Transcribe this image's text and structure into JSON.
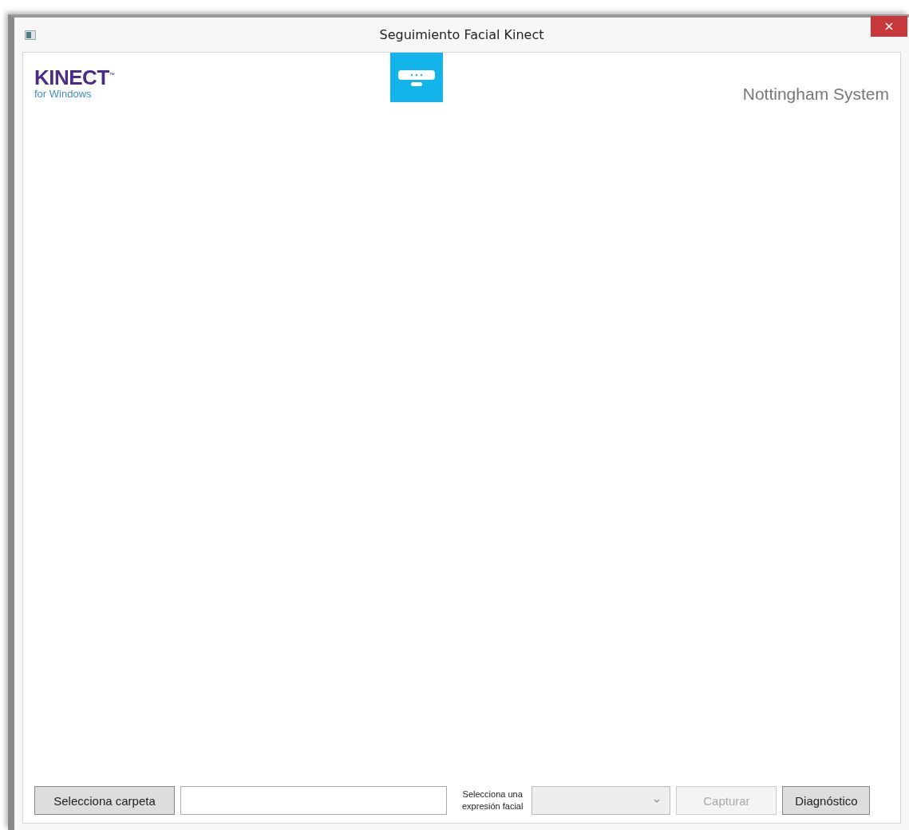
{
  "window": {
    "title": "Seguimiento Facial Kinect"
  },
  "header": {
    "logo_title": "KINECT$^{™}$",
    "logo_subtitle": "for Windows",
    "app_name": "Nottingham System"
  },
  "toolbar": {
    "folder_button": {
      "label": "Selecciona carpeta",
      "disabled": false
    },
    "expression_label": [
      "Selecciona una",
      "expresión facial"
    ],
    "expression_select": {
      "disabled": true
    },
    "capture_button": {
      "label": "Capturar",
      "disabled": true
    },
    "diagnostic_button": {
      "label": "Diagnóstico",
      "disabled": false
    }
  }
}
